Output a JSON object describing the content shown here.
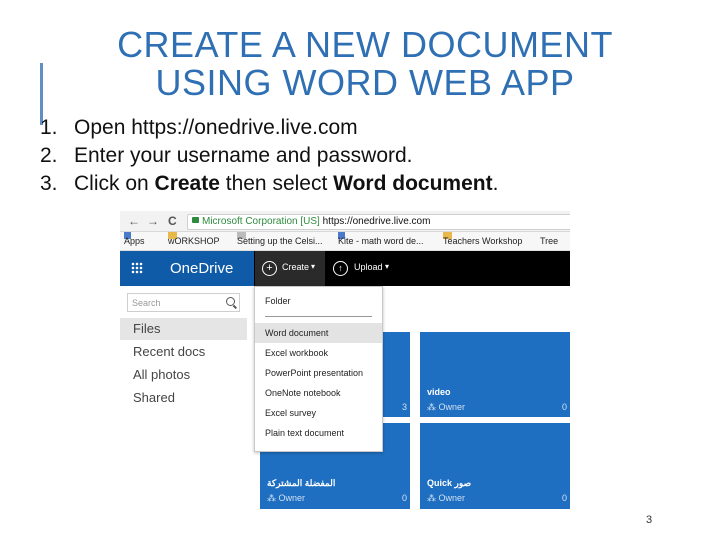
{
  "slide": {
    "title_line1": "CREATE A NEW DOCUMENT",
    "title_line2": "USING WORD WEB APP",
    "steps": [
      {
        "num": "1.",
        "text": "Open https://onedrive.live.com"
      },
      {
        "num": "2.",
        "text": "Enter your username and password."
      },
      {
        "num": "3.",
        "prefix": "Click on ",
        "bold1": "Create",
        "middle": " then select ",
        "bold2": "Word document",
        "suffix": "."
      }
    ],
    "page_number": "3",
    "accent_color": "#2f6fb3"
  },
  "browser": {
    "back": "←",
    "forward": "→",
    "reload": "C",
    "ev_cert": "Microsoft Corporation [US]",
    "url": "https://onedrive.live.com",
    "bookmarks": [
      "Apps",
      "wORKSHOP",
      "Setting up the Celsi...",
      "Kite - math word de...",
      "Teachers Workshop",
      "Tree"
    ]
  },
  "onedrive": {
    "brand": "OneDrive",
    "brand_color": "#0f5ba8",
    "create_label": "Create",
    "upload_label": "Upload",
    "search_placeholder": "Search",
    "sidebar": [
      "Files",
      "Recent docs",
      "All photos",
      "Shared"
    ],
    "create_menu": [
      "Folder",
      "Word document",
      "Excel workbook",
      "PowerPoint presentation",
      "OneNote notebook",
      "Excel survey",
      "Plain text document"
    ],
    "tiles": [
      {
        "name": "",
        "owner": "",
        "count": "3"
      },
      {
        "name": "video",
        "owner": "Owner",
        "count": "0"
      },
      {
        "name": "المفضلة المشتركة",
        "owner": "Owner",
        "count": "0"
      },
      {
        "name": "Quick صور",
        "owner": "Owner",
        "count": "0"
      }
    ]
  }
}
